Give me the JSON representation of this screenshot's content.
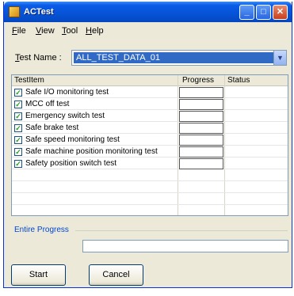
{
  "window": {
    "title": "ACTest"
  },
  "menu": {
    "file": "File",
    "view": "View",
    "tool": "Tool",
    "help": "Help"
  },
  "test_name": {
    "label": "Test Name :",
    "value": "ALL_TEST_DATA_01"
  },
  "grid": {
    "headers": {
      "item": "TestItem",
      "progress": "Progress",
      "status": "Status"
    },
    "rows": [
      {
        "label": "Safe I/O monitoring test",
        "checked": true
      },
      {
        "label": "MCC off test",
        "checked": true
      },
      {
        "label": "Emergency switch test",
        "checked": true
      },
      {
        "label": "Safe brake test",
        "checked": true
      },
      {
        "label": "Safe speed monitoring test",
        "checked": true
      },
      {
        "label": "Safe machine position monitoring test",
        "checked": true
      },
      {
        "label": "Safety position switch test",
        "checked": true
      }
    ]
  },
  "progress": {
    "label": "Entire Progress"
  },
  "buttons": {
    "start": "Start",
    "cancel": "Cancel"
  }
}
